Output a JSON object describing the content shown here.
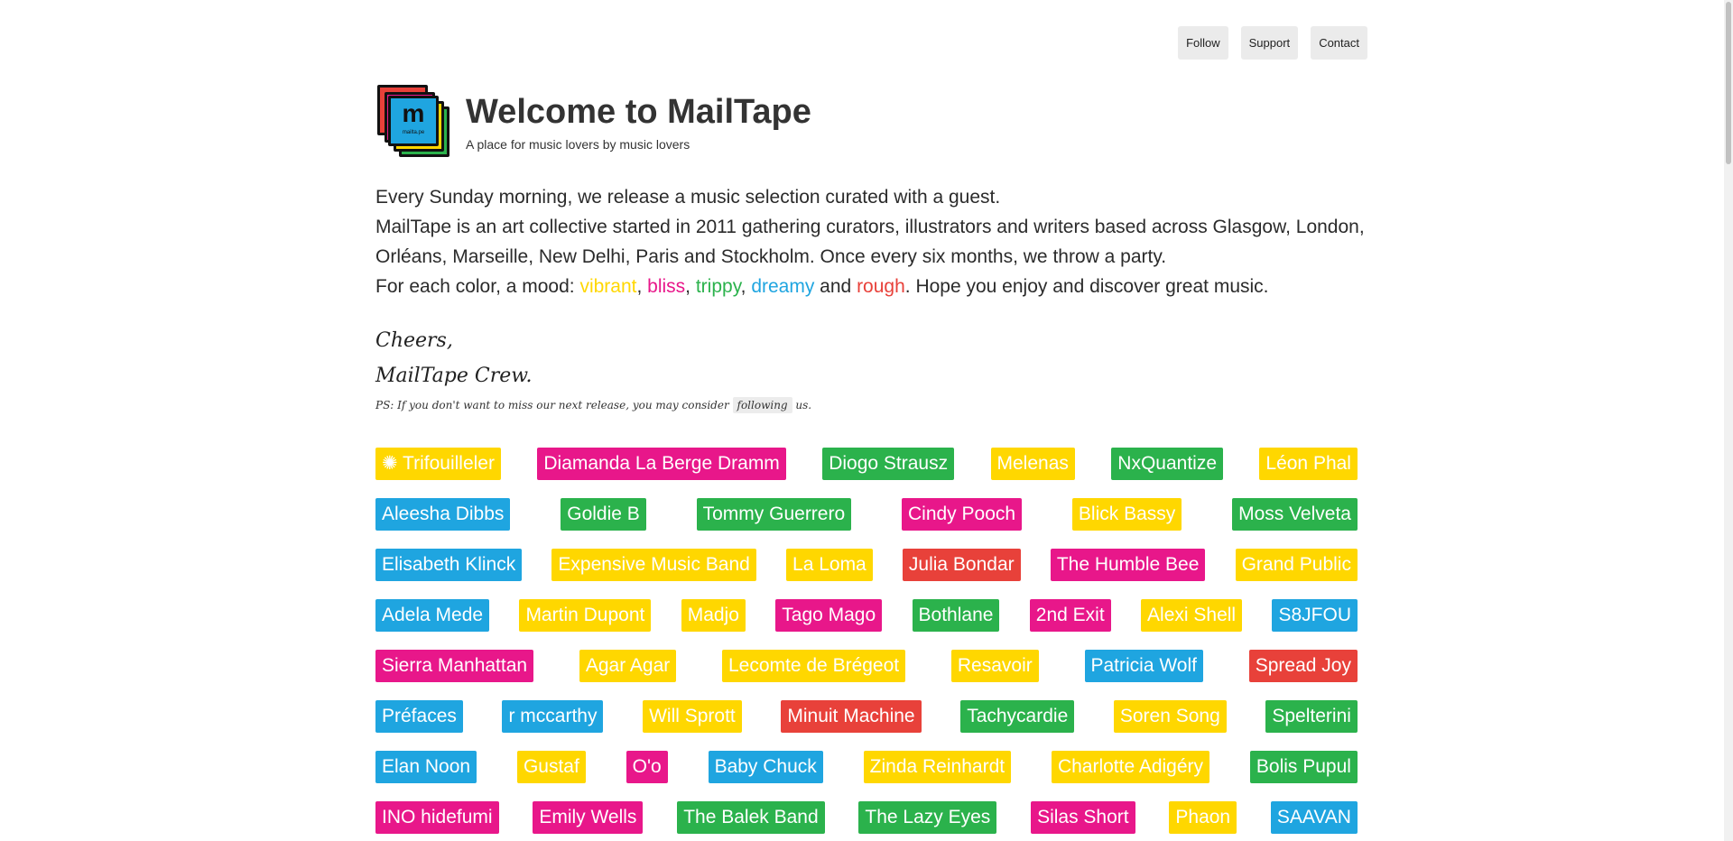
{
  "nav": {
    "follow": "Follow",
    "support": "Support",
    "contact": "Contact"
  },
  "header": {
    "title": "Welcome to MailTape",
    "subtitle": "A place for music lovers by music lovers",
    "logo_letter": "m",
    "logo_tag": "mailta.pe"
  },
  "intro": {
    "line1": "Every Sunday morning, we release a music selection curated with a guest.",
    "line2": "MailTape is an art collective started in 2011 gathering curators, illustrators and writers based across Glasgow, London, Orléans, Marseille, New Delhi, Paris and Stockholm. Once every six months, we throw a party.",
    "mood_prefix": "For each color, a mood: ",
    "mood_vibrant": "vibrant",
    "comma": ", ",
    "mood_bliss": "bliss",
    "mood_trippy": "trippy",
    "mood_dreamy": "dreamy",
    "and": " and ",
    "mood_rough": "rough",
    "mood_suffix": ". Hope you enjoy and discover great music."
  },
  "sign": {
    "line1": "Cheers,",
    "line2": "MailTape Crew."
  },
  "ps": {
    "prefix": "PS: If you don't want to miss our next release, you may consider ",
    "link": "following",
    "suffix": " us."
  },
  "colors": {
    "yellow": "#ffd700",
    "pink": "#e8178a",
    "green": "#2bb24c",
    "blue": "#1fa5e0",
    "red": "#e8413a"
  },
  "artist_rows": [
    [
      {
        "name": "✺ Trifouilleler",
        "color": "yellow"
      },
      {
        "name": "Diamanda La Berge Dramm",
        "color": "pink"
      },
      {
        "name": "Diogo Strausz",
        "color": "green"
      },
      {
        "name": "Melenas",
        "color": "yellow"
      },
      {
        "name": "NxQuantize",
        "color": "green"
      },
      {
        "name": "Léon Phal",
        "color": "yellow"
      }
    ],
    [
      {
        "name": "Aleesha Dibbs",
        "color": "blue"
      },
      {
        "name": "Goldie B",
        "color": "green"
      },
      {
        "name": "Tommy Guerrero",
        "color": "green"
      },
      {
        "name": "Cindy Pooch",
        "color": "pink"
      },
      {
        "name": "Blick Bassy",
        "color": "yellow"
      },
      {
        "name": "Moss Velveta",
        "color": "green"
      }
    ],
    [
      {
        "name": "Elisabeth Klinck",
        "color": "blue"
      },
      {
        "name": "Expensive Music Band",
        "color": "yellow"
      },
      {
        "name": "La Loma",
        "color": "yellow"
      },
      {
        "name": "Julia Bondar",
        "color": "red"
      },
      {
        "name": "The Humble Bee",
        "color": "pink"
      },
      {
        "name": "Grand Public",
        "color": "yellow"
      }
    ],
    [
      {
        "name": "Adela Mede",
        "color": "blue"
      },
      {
        "name": "Martin Dupont",
        "color": "yellow"
      },
      {
        "name": "Madjo",
        "color": "yellow"
      },
      {
        "name": "Tago Mago",
        "color": "pink"
      },
      {
        "name": "Bothlane",
        "color": "green"
      },
      {
        "name": "2nd Exit",
        "color": "pink"
      },
      {
        "name": "Alexi Shell",
        "color": "yellow"
      },
      {
        "name": "S8JFOU",
        "color": "blue"
      }
    ],
    [
      {
        "name": "Sierra Manhattan",
        "color": "pink"
      },
      {
        "name": "Agar Agar",
        "color": "yellow"
      },
      {
        "name": "Lecomte de Brégeot",
        "color": "yellow"
      },
      {
        "name": "Resavoir",
        "color": "yellow"
      },
      {
        "name": "Patricia Wolf",
        "color": "blue"
      },
      {
        "name": "Spread Joy",
        "color": "red"
      }
    ],
    [
      {
        "name": "Préfaces",
        "color": "blue"
      },
      {
        "name": "r mccarthy",
        "color": "blue"
      },
      {
        "name": "Will Sprott",
        "color": "yellow"
      },
      {
        "name": "Minuit Machine",
        "color": "red"
      },
      {
        "name": "Tachycardie",
        "color": "green"
      },
      {
        "name": "Soren Song",
        "color": "yellow"
      },
      {
        "name": "Spelterini",
        "color": "green"
      }
    ],
    [
      {
        "name": "Elan Noon",
        "color": "blue"
      },
      {
        "name": "Gustaf",
        "color": "yellow"
      },
      {
        "name": "O'o",
        "color": "pink"
      },
      {
        "name": "Baby Chuck",
        "color": "blue"
      },
      {
        "name": "Zinda Reinhardt",
        "color": "yellow"
      },
      {
        "name": "Charlotte Adigéry",
        "color": "yellow"
      },
      {
        "name": "Bolis Pupul",
        "color": "green"
      }
    ],
    [
      {
        "name": "INO hidefumi",
        "color": "pink"
      },
      {
        "name": "Emily Wells",
        "color": "pink"
      },
      {
        "name": "The Balek Band",
        "color": "green"
      },
      {
        "name": "The Lazy Eyes",
        "color": "green"
      },
      {
        "name": "Silas Short",
        "color": "pink"
      },
      {
        "name": "Phaon",
        "color": "yellow"
      },
      {
        "name": "SAAVAN",
        "color": "blue"
      }
    ]
  ]
}
